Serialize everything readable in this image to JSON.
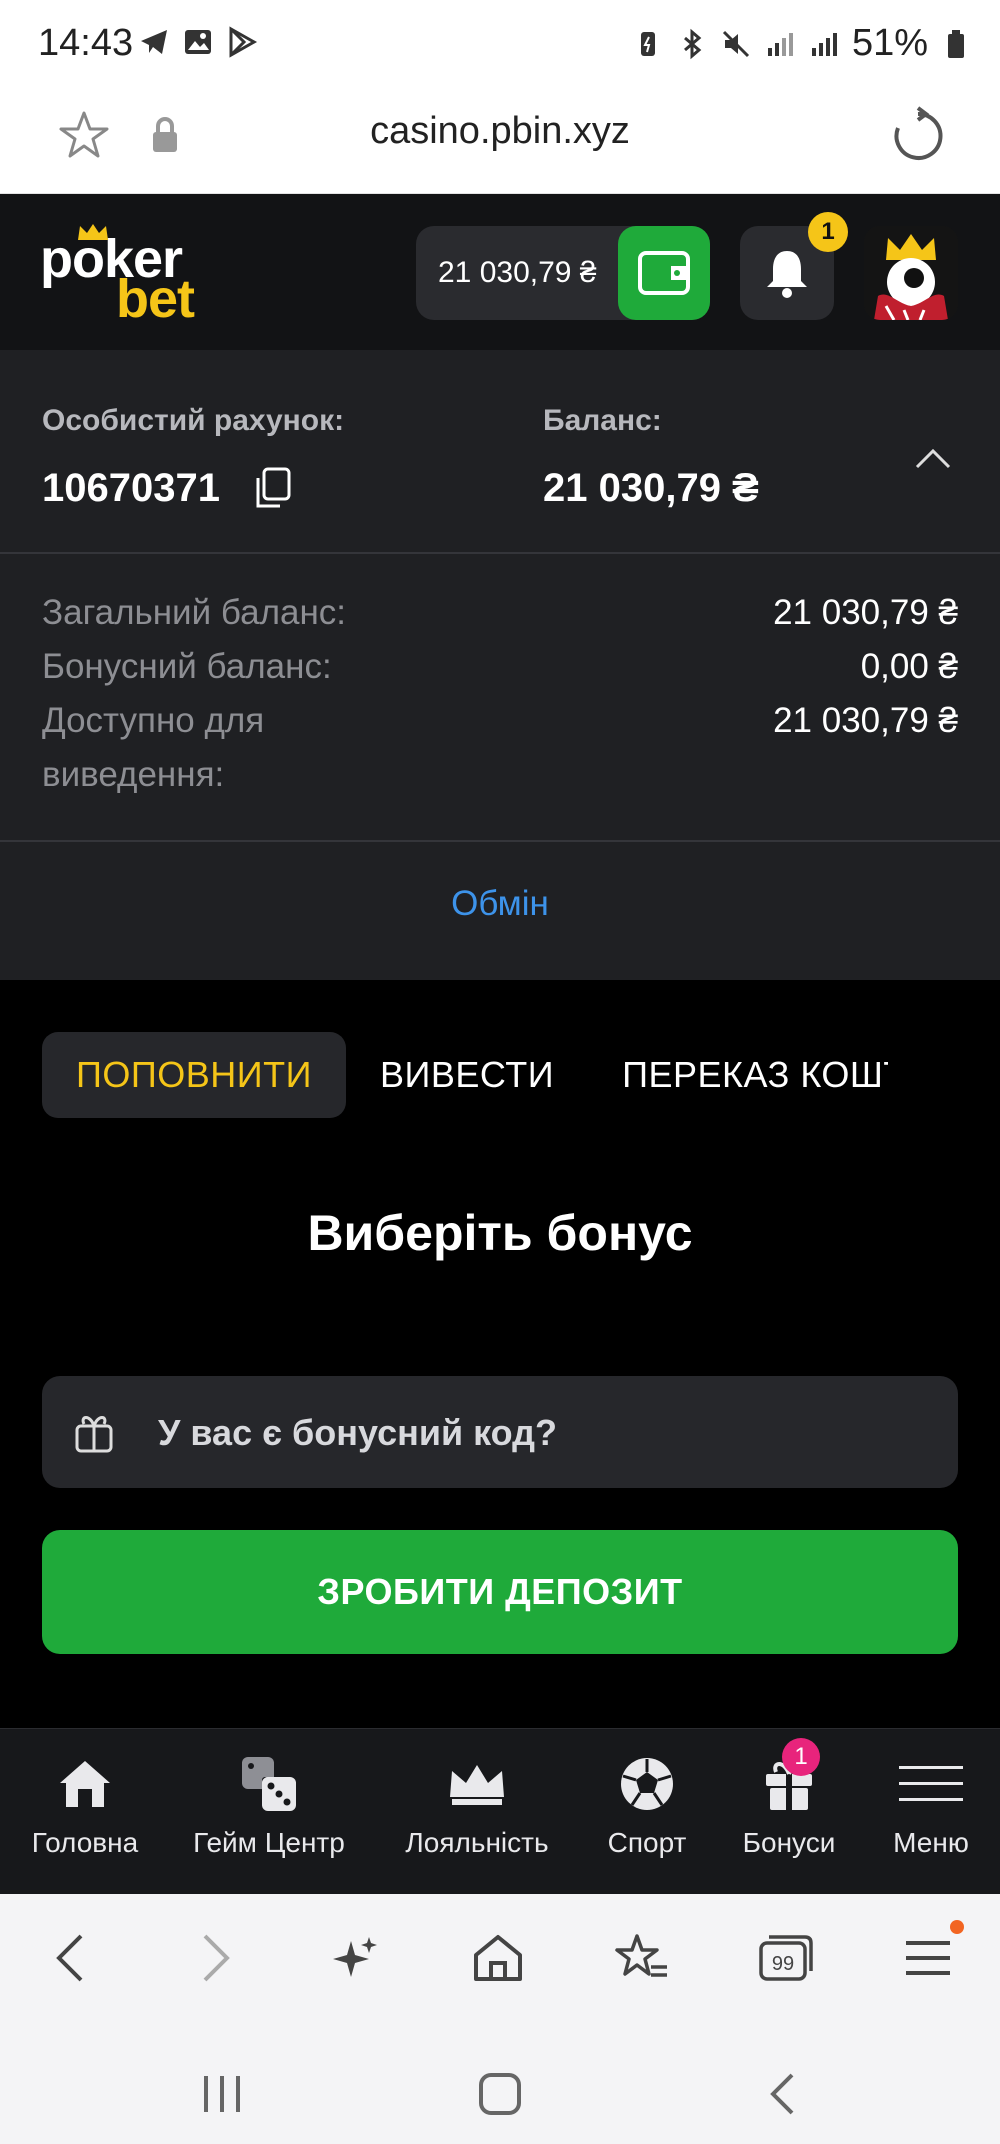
{
  "status_bar": {
    "time": "14:43",
    "battery": "51%"
  },
  "browser": {
    "url": "casino.pbin.xyz"
  },
  "header": {
    "logo_top": "poker",
    "logo_bottom": "bet",
    "balance": "21 030,79 ₴",
    "notifications_count": "1"
  },
  "account": {
    "account_label": "Особистий рахунок:",
    "account_number": "10670371",
    "balance_label": "Баланс:",
    "balance_value": "21 030,79 ₴"
  },
  "details": [
    {
      "label": "Загальний баланс:",
      "value": "21 030,79 ₴"
    },
    {
      "label": "Бонусний баланс:",
      "value": "0,00 ₴"
    },
    {
      "label": "Доступно для",
      "label2": "виведення:",
      "value": "21 030,79 ₴"
    }
  ],
  "exchange_link": "Обмін",
  "tabs": [
    {
      "label": "ПОПОВНИТИ",
      "active": true
    },
    {
      "label": "ВИВЕСТИ",
      "active": false
    },
    {
      "label": "ПЕРЕКАЗ КОШТІВ",
      "active": false
    }
  ],
  "bonus_section": {
    "title": "Виберіть бонус",
    "promo_placeholder": "У вас є бонусний код?",
    "deposit_button": "ЗРОБИТИ ДЕПОЗИТ"
  },
  "bottom_nav": [
    {
      "label": "Головна",
      "icon": "home-icon"
    },
    {
      "label": "Гейм Центр",
      "icon": "dice-icon"
    },
    {
      "label": "Лояльність",
      "icon": "crown-icon"
    },
    {
      "label": "Спорт",
      "icon": "soccer-ball-icon"
    },
    {
      "label": "Бонуси",
      "icon": "gift-icon",
      "badge": "1"
    },
    {
      "label": "Меню",
      "icon": "hamburger-icon"
    }
  ],
  "colors": {
    "accent_yellow": "#f5c518",
    "green": "#1faa3a",
    "link_blue": "#3d93ea",
    "badge_pink": "#e8247c"
  }
}
